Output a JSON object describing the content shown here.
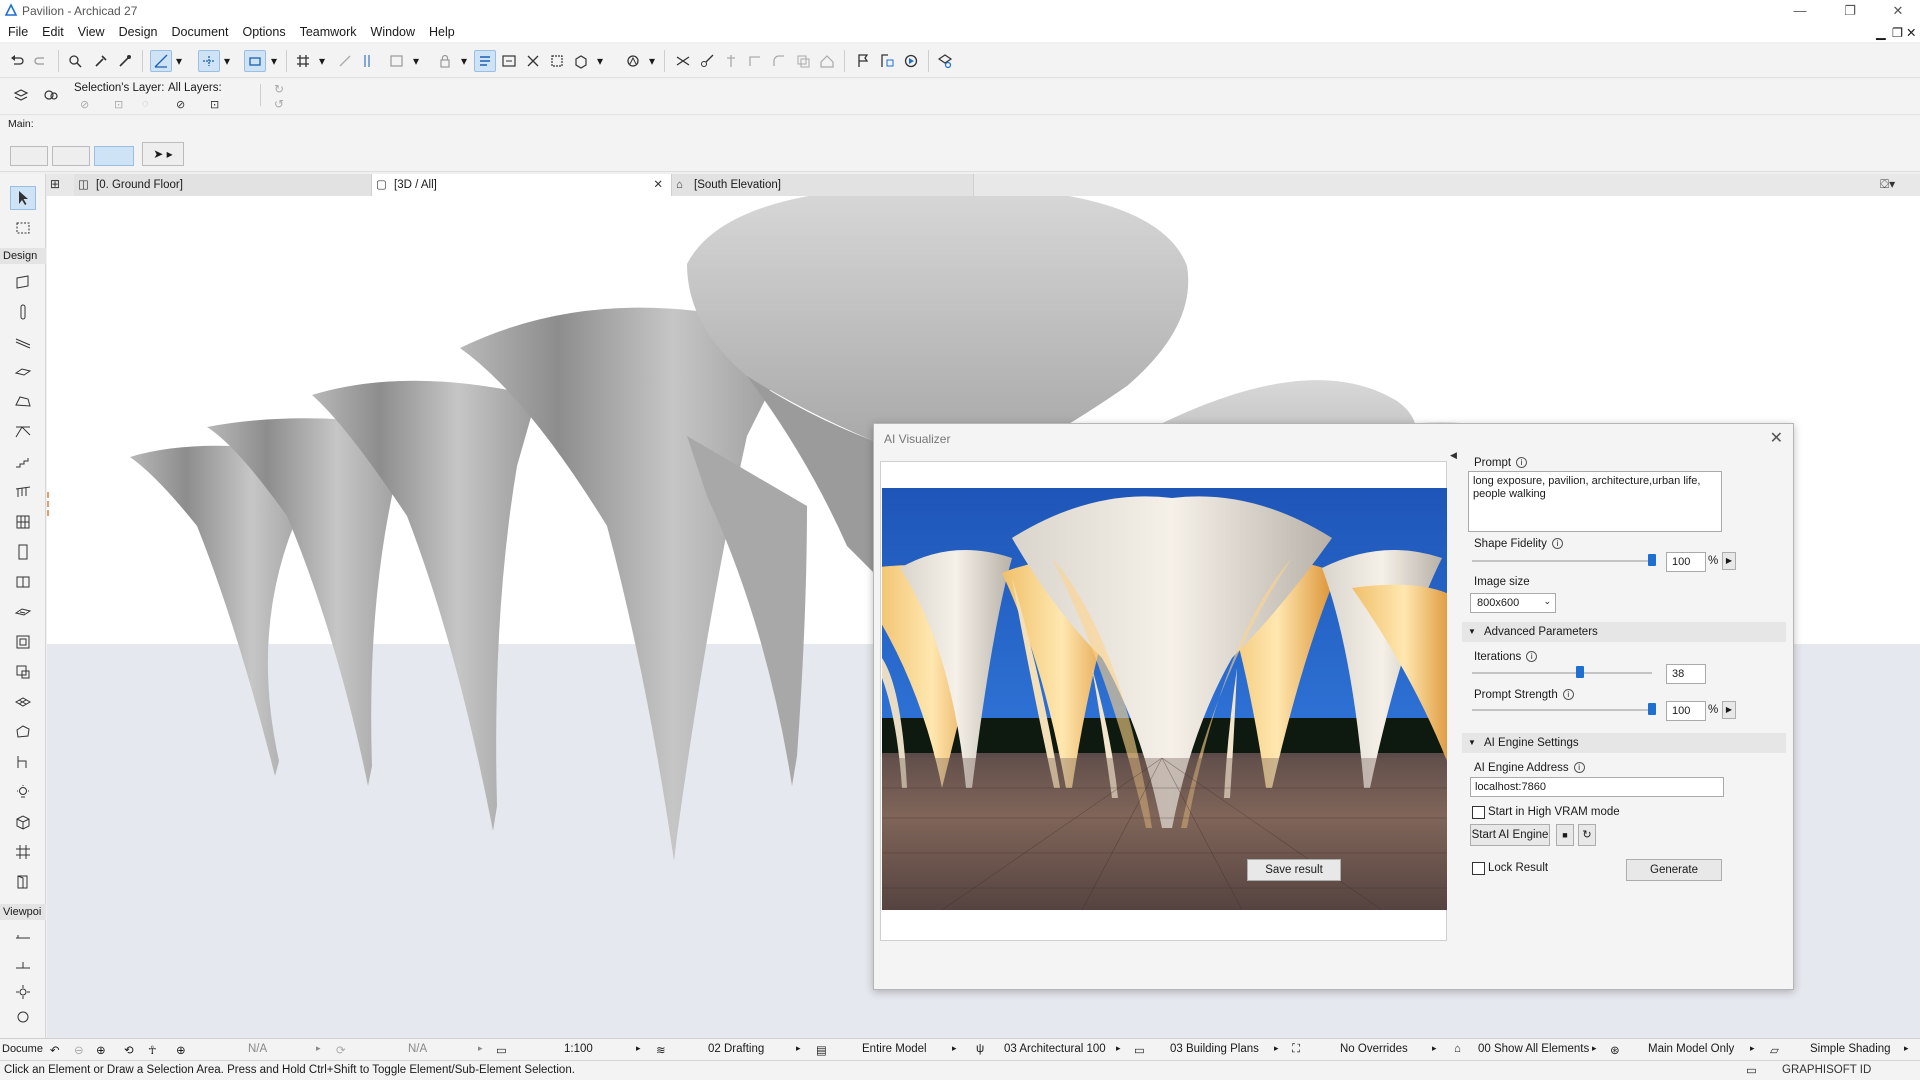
{
  "app": {
    "title": "Pavilion - Archicad 27"
  },
  "menu": [
    "File",
    "Edit",
    "View",
    "Design",
    "Document",
    "Options",
    "Teamwork",
    "Window",
    "Help"
  ],
  "layers": {
    "selection_layer_label": "Selection's Layer:",
    "all_layers_label": "All Layers:"
  },
  "infobox": {
    "main_label": "Main:"
  },
  "tabs": [
    {
      "label": "[0. Ground Floor]"
    },
    {
      "label": "[3D / All]"
    },
    {
      "label": "[South Elevation]"
    }
  ],
  "toolbox": {
    "design_header": "Design",
    "viewpoint_header": "Viewpoi",
    "document_header": "Docume"
  },
  "dialog": {
    "title": "AI Visualizer",
    "prompt_label": "Prompt",
    "prompt_value": "long exposure, pavilion, architecture,urban life, people walking",
    "shape_fidelity_label": "Shape Fidelity",
    "shape_fidelity_value": "100",
    "shape_fidelity_fraction": 1.0,
    "image_size_label": "Image size",
    "image_size_value": "800x600",
    "advanced_section": "Advanced Parameters",
    "iterations_label": "Iterations",
    "iterations_value": "38",
    "iterations_fraction": 0.6,
    "prompt_strength_label": "Prompt Strength",
    "prompt_strength_value": "100",
    "prompt_strength_fraction": 1.0,
    "engine_section": "AI Engine Settings",
    "engine_address_label": "AI Engine Address",
    "engine_address_value": "localhost:7860",
    "high_vram_label": "Start in High VRAM mode",
    "start_engine_button": "Start AI Engine",
    "lock_result_label": "Lock Result",
    "save_result_button": "Save result",
    "generate_button": "Generate",
    "percent": "%"
  },
  "statusbar": {
    "na1": "N/A",
    "na2": "N/A",
    "scale": "1:100",
    "layer_combo": "02 Drafting",
    "model_view": "Entire Model",
    "pen_set": "03 Architectural 100",
    "mvo": "03 Building Plans",
    "overrides": "No Overrides",
    "renovation": "00 Show All Elements",
    "structure": "Main Model Only",
    "shading": "Simple Shading"
  },
  "bottombar": {
    "hint": "Click an Element or Draw a Selection Area. Press and Hold Ctrl+Shift to Toggle Element/Sub-Element Selection.",
    "brand": "GRAPHISOFT ID"
  },
  "colors": {
    "accent": "#1f6fd0",
    "selection": "#cfe3f7"
  }
}
